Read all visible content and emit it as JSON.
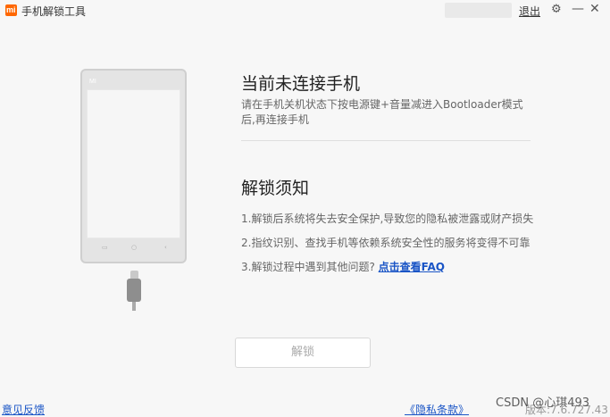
{
  "window": {
    "logo_text": "mi",
    "title": "手机解锁工具",
    "logout_label": "退出",
    "settings_icon": "gear-icon",
    "minimize_label": "—",
    "close_label": "✕"
  },
  "phone": {
    "brand": "MI",
    "nav_icons": [
      "▭",
      "○",
      "‹"
    ]
  },
  "main": {
    "heading": "当前未连接手机",
    "instruction": "请在手机关机状态下按电源键+音量减进入Bootloader模式后,再连接手机"
  },
  "notice": {
    "heading": "解锁须知",
    "items": [
      "1.解锁后系统将失去安全保护,导致您的隐私被泄露或财产损失",
      "2.指纹识别、查找手机等依赖系统安全性的服务将变得不可靠"
    ],
    "item3_prefix": "3.解锁过程中遇到其他问题?",
    "item3_link": "点击查看FAQ"
  },
  "unlock_button": "解锁",
  "footer": {
    "feedback": "意见反馈",
    "privacy": "《隐私条款》",
    "version": "版本:7.6.727.43"
  },
  "watermark": "CSDN @心琪493"
}
